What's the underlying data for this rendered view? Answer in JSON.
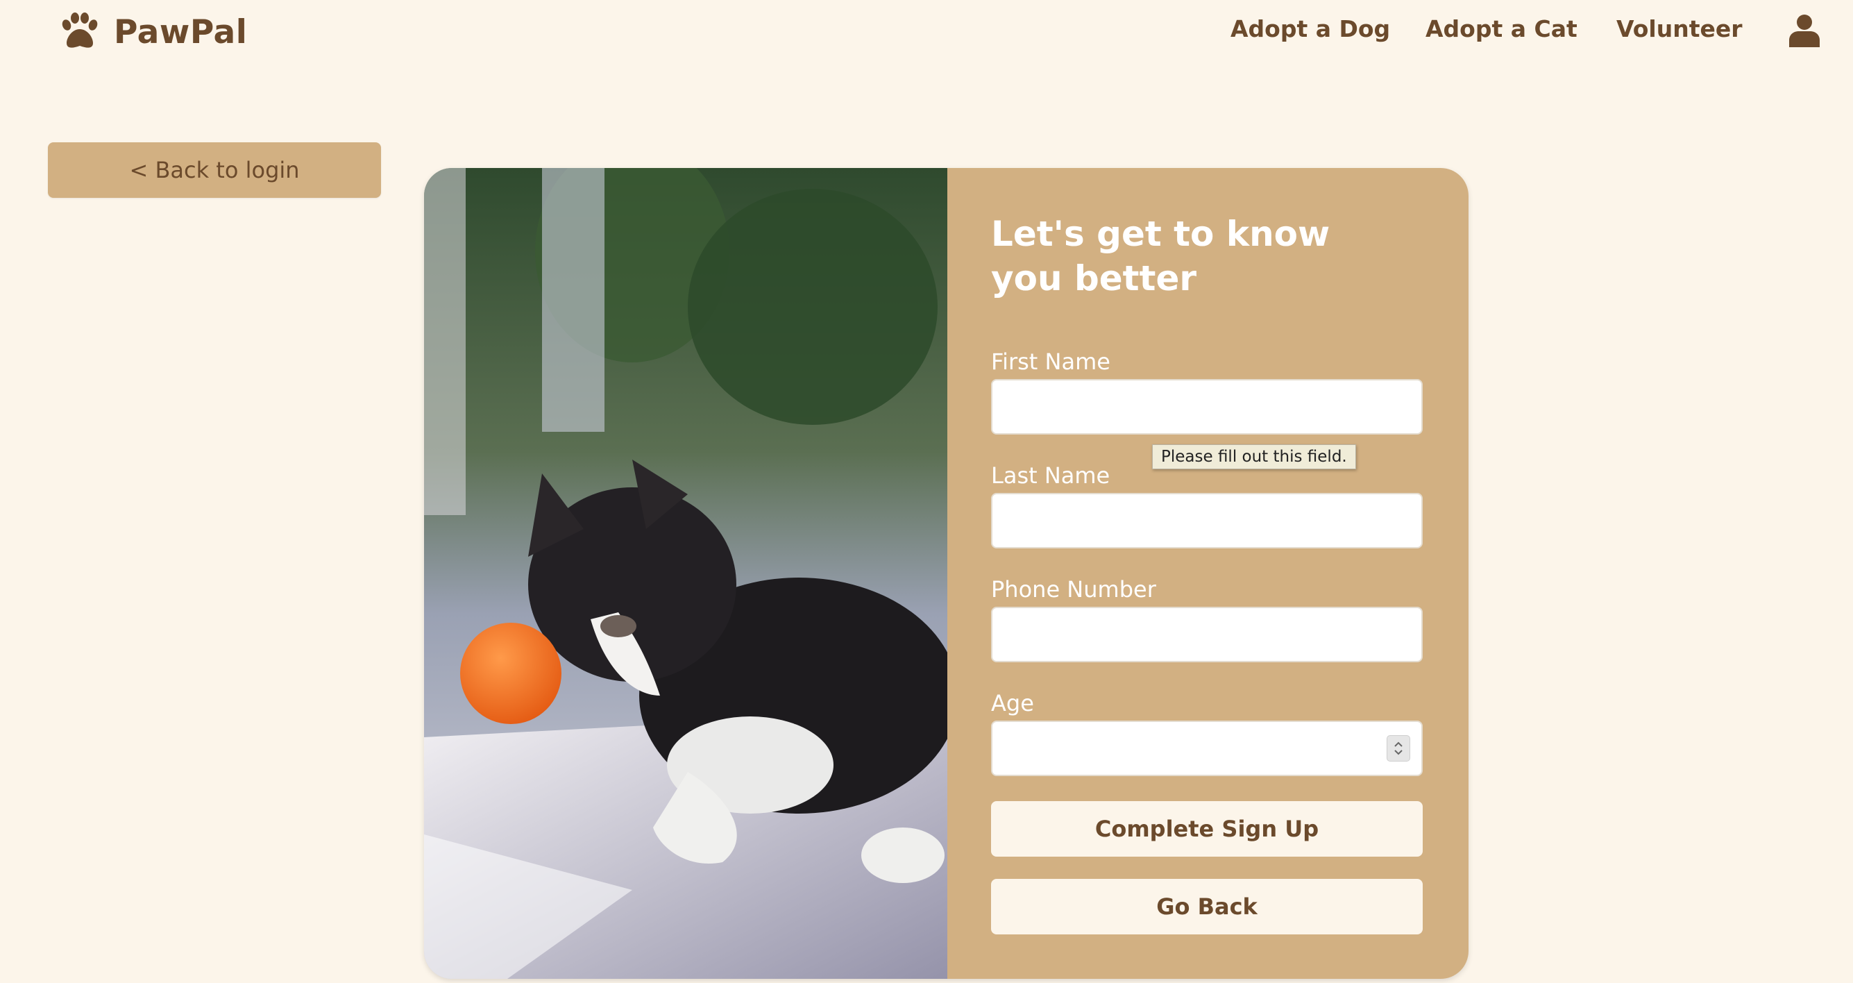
{
  "header": {
    "brand": "PawPal",
    "nav": [
      "Adopt a Dog",
      "Adopt a Cat",
      "Volunteer"
    ]
  },
  "back_link": "< Back to login",
  "form": {
    "title": "Let's get to know you better",
    "fields": [
      {
        "label": "First Name",
        "value": ""
      },
      {
        "label": "Last Name",
        "value": ""
      },
      {
        "label": "Phone Number",
        "value": ""
      },
      {
        "label": "Age",
        "value": ""
      }
    ],
    "validation_tooltip": "Please fill out this field.",
    "submit_label": "Complete Sign Up",
    "go_back_label": "Go Back"
  },
  "icons": {
    "logo": "paw-icon",
    "account": "user-icon"
  },
  "colors": {
    "background": "#fcf5ea",
    "accent": "#d2b082",
    "text_brown": "#6b4a2c"
  }
}
